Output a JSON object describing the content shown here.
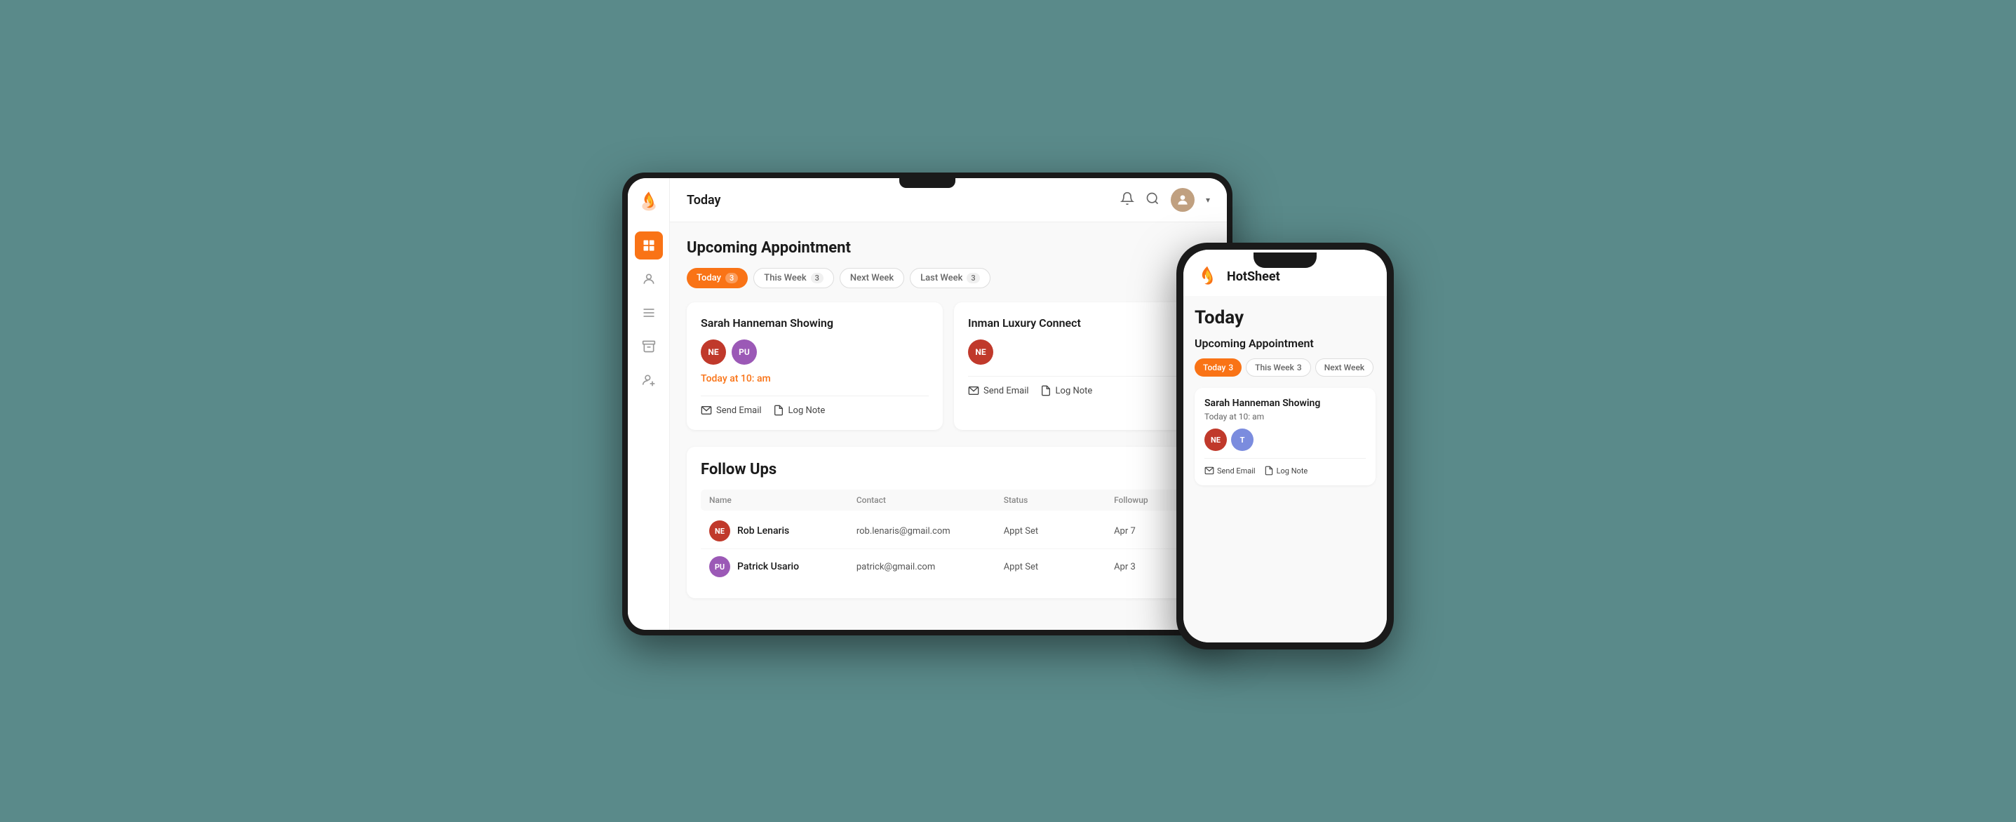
{
  "colors": {
    "orange": "#f97316",
    "sidebar_active": "#f97316",
    "ne_avatar": "#c0392b",
    "pu_avatar": "#9b59b6",
    "t_avatar": "#7b8cde"
  },
  "tablet": {
    "header": {
      "title": "Today",
      "icons": [
        "bell",
        "search",
        "user-avatar",
        "chevron-down"
      ]
    },
    "sidebar": {
      "items": [
        {
          "name": "grid-icon",
          "active": true
        },
        {
          "name": "person-icon",
          "active": false
        },
        {
          "name": "list-icon",
          "active": false
        },
        {
          "name": "archive-icon",
          "active": false
        },
        {
          "name": "add-person-icon",
          "active": false
        }
      ]
    },
    "upcoming_appointment": {
      "title": "Upcoming Appointment",
      "filter_tabs": [
        {
          "label": "Today",
          "count": "3",
          "active": true
        },
        {
          "label": "This Week",
          "count": "3",
          "active": false
        },
        {
          "label": "Next Week",
          "count": "",
          "active": false
        },
        {
          "label": "Last Week",
          "count": "3",
          "active": false
        }
      ],
      "cards": [
        {
          "title": "Sarah Hanneman Showing",
          "avatars": [
            {
              "initials": "NE",
              "color": "#c0392b"
            },
            {
              "initials": "PU",
              "color": "#9b59b6"
            }
          ],
          "time": "Today at 10: am",
          "actions": [
            {
              "label": "Send Email",
              "icon": "email"
            },
            {
              "label": "Log Note",
              "icon": "note"
            }
          ]
        },
        {
          "title": "Inman Luxury Connect",
          "avatars": [
            {
              "initials": "NE",
              "color": "#c0392b"
            }
          ],
          "time": "",
          "actions": [
            {
              "label": "Send Email",
              "icon": "email"
            },
            {
              "label": "Log Note",
              "icon": "note"
            }
          ]
        }
      ]
    },
    "follow_ups": {
      "title": "Follow Ups",
      "table": {
        "headers": [
          "Name",
          "Contact",
          "Status",
          "Followup"
        ],
        "rows": [
          {
            "avatar": {
              "initials": "NE",
              "color": "#c0392b"
            },
            "name": "Rob Lenaris",
            "contact": "rob.lenaris@gmail.com",
            "status": "Appt Set",
            "followup": "Apr 7"
          },
          {
            "avatar": {
              "initials": "PU",
              "color": "#9b59b6"
            },
            "name": "Patrick Usario",
            "contact": "patrick@gmail.com",
            "status": "Appt Set",
            "followup": "Apr 3"
          }
        ]
      }
    }
  },
  "phone": {
    "app_name": "HotSheet",
    "page_title": "Today",
    "upcoming_appointment": {
      "title": "Upcoming Appointment",
      "filter_tabs": [
        {
          "label": "Today",
          "count": "3",
          "active": true
        },
        {
          "label": "This Week",
          "count": "3",
          "active": false
        },
        {
          "label": "Next Week",
          "count": "",
          "active": false
        }
      ],
      "card": {
        "title": "Sarah Hanneman Showing",
        "time": "Today at 10: am",
        "avatars": [
          {
            "initials": "NE",
            "color": "#c0392b"
          },
          {
            "initials": "T",
            "color": "#7b8cde"
          }
        ],
        "actions": [
          {
            "label": "Send Email",
            "icon": "email"
          },
          {
            "label": "Log Note",
            "icon": "note"
          }
        ]
      }
    }
  }
}
